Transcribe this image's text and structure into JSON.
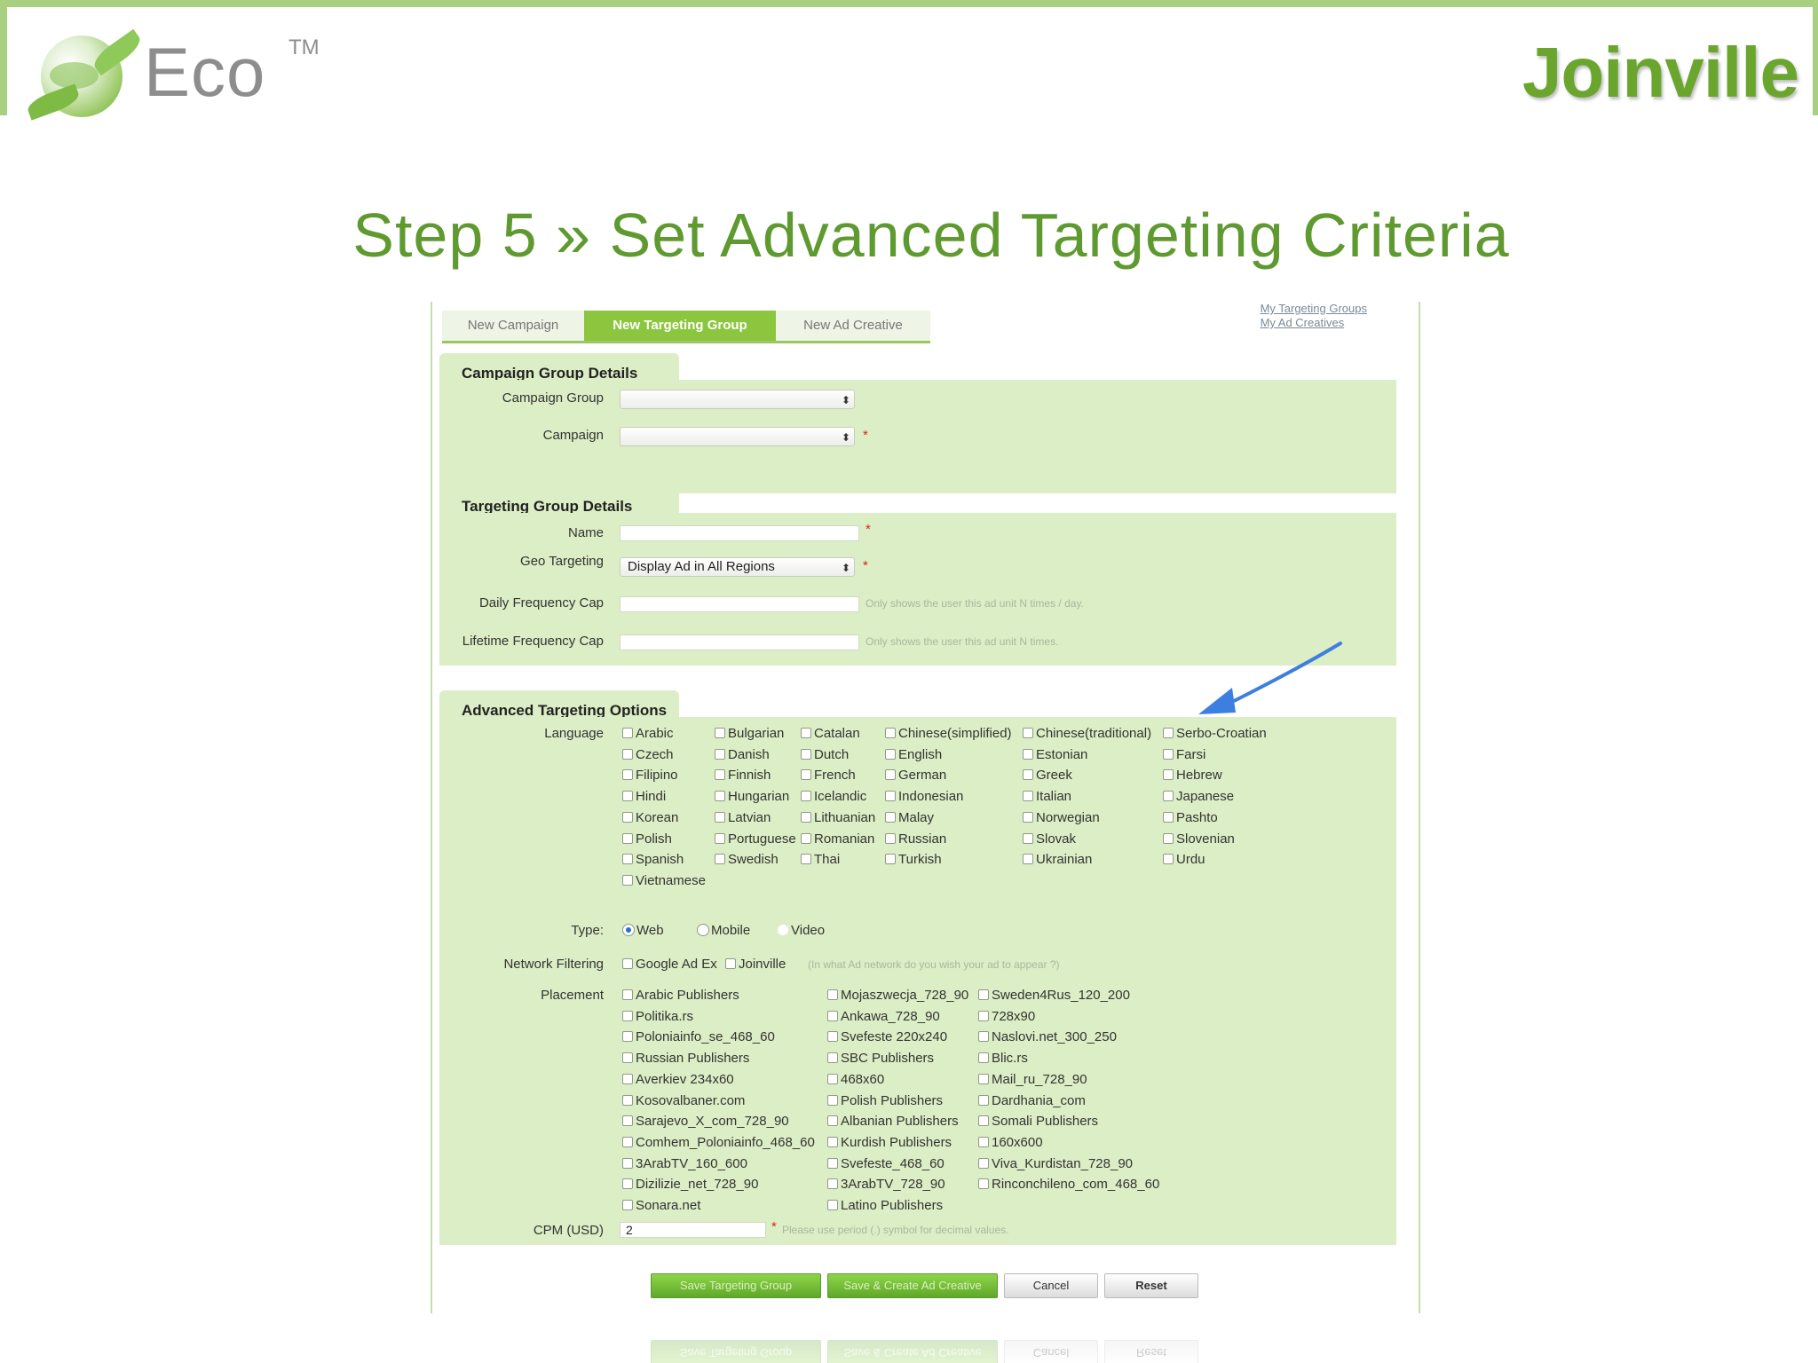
{
  "brand": {
    "eco": "Eco",
    "tm": "TM",
    "joinville": "Joinville"
  },
  "slide_title": "Step 5 » Set Advanced Targeting Criteria",
  "app": {
    "toplinks": [
      "My Targeting Groups",
      "My Ad Creatives"
    ],
    "tabs": [
      "New Campaign",
      "New Targeting Group",
      "New Ad Creative"
    ],
    "campaign_group_details": {
      "title": "Campaign Group Details",
      "campaign_group_label": "Campaign Group",
      "campaign_label": "Campaign"
    },
    "targeting_group_details": {
      "title": "Targeting Group Details",
      "name_label": "Name",
      "geo_label": "Geo Targeting",
      "geo_value": "Display Ad in All Regions",
      "daily_label": "Daily Frequency Cap",
      "daily_hint": "Only shows the user this ad unit N times / day.",
      "lifetime_label": "Lifetime Frequency Cap",
      "lifetime_hint": "Only shows the user this ad unit N times."
    },
    "advanced": {
      "title": "Advanced Targeting Options",
      "language_label": "Language",
      "languages": [
        [
          "Arabic",
          "Bulgarian",
          "Catalan",
          "Chinese(simplified)",
          "Chinese(traditional)",
          "Serbo-Croatian"
        ],
        [
          "Czech",
          "Danish",
          "Dutch",
          "English",
          "Estonian",
          "Farsi"
        ],
        [
          "Filipino",
          "Finnish",
          "French",
          "German",
          "Greek",
          "Hebrew"
        ],
        [
          "Hindi",
          "Hungarian",
          "Icelandic",
          "Indonesian",
          "Italian",
          "Japanese"
        ],
        [
          "Korean",
          "Latvian",
          "Lithuanian",
          "Malay",
          "Norwegian",
          "Pashto"
        ],
        [
          "Polish",
          "Portuguese",
          "Romanian",
          "Russian",
          "Slovak",
          "Slovenian"
        ],
        [
          "Spanish",
          "Swedish",
          "Thai",
          "Turkish",
          "Ukrainian",
          "Urdu"
        ],
        [
          "Vietnamese"
        ]
      ],
      "type_label": "Type:",
      "types": [
        "Web",
        "Mobile",
        "Video"
      ],
      "type_selected": "Web",
      "network_label": "Network Filtering",
      "networks": [
        "Google Ad Ex",
        "Joinville"
      ],
      "network_hint": "(In what Ad network do you wish your ad to appear ?)",
      "placement_label": "Placement",
      "placements": [
        [
          "Arabic Publishers",
          "Politika.rs",
          "Poloniainfo_se_468_60",
          "Russian Publishers",
          "Averkiev 234x60",
          "Kosovalbaner.com",
          "Sarajevo_X_com_728_90",
          "Comhem_Poloniainfo_468_60",
          "3ArabTV_160_600",
          "Dizilizie_net_728_90",
          "Sonara.net"
        ],
        [
          "Mojaszwecja_728_90",
          "Ankawa_728_90",
          "Svefeste 220x240",
          "SBC Publishers",
          "468x60",
          "Polish Publishers",
          "Albanian Publishers",
          "Kurdish Publishers",
          "Svefeste_468_60",
          "3ArabTV_728_90",
          "Latino Publishers"
        ],
        [
          "Sweden4Rus_120_200",
          "728x90",
          "Naslovi.net_300_250",
          "Blic.rs",
          "Mail_ru_728_90",
          "Dardhania_com",
          "Somali Publishers",
          "160x600",
          "Viva_Kurdistan_728_90",
          "Rinconchileno_com_468_60"
        ]
      ],
      "cpm_label": "CPM (USD)",
      "cpm_value": "2",
      "cpm_hint": "Please use period (.) symbol for decimal values."
    },
    "buttons": {
      "save": "Save Targeting Group",
      "save_create": "Save & Create Ad Creative",
      "cancel": "Cancel",
      "reset": "Reset"
    }
  },
  "colors": {
    "title_green": "#5f9a30",
    "panel_green": "#dceec5",
    "tab_active": "#8cc63f",
    "arrow_blue": "#3d7fe0"
  }
}
